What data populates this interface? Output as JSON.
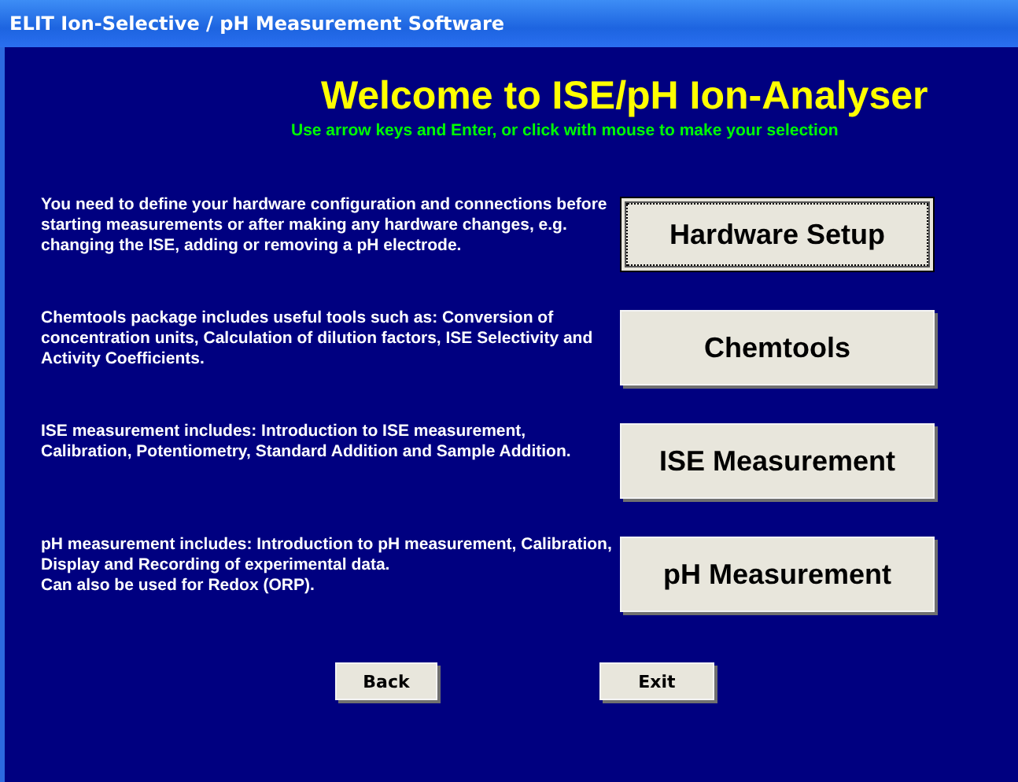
{
  "window": {
    "title": "ELIT Ion-Selective / pH Measurement Software"
  },
  "heading": "Welcome to ISE/pH Ion-Analyser",
  "subheading": "Use arrow keys and Enter, or click with mouse to make your selection",
  "options": [
    {
      "description": "You need to define your hardware configuration and connections before starting measurements or after making any hardware changes, e.g. changing the ISE,  adding or removing a pH electrode.",
      "button": "Hardware Setup",
      "selected": true
    },
    {
      "description": "Chemtools package includes useful tools such as: Conversion of concentration units, Calculation of dilution factors, ISE Selectivity and Activity Coefficients.",
      "button": "Chemtools",
      "selected": false
    },
    {
      "description": "ISE measurement includes: Introduction to ISE measurement, Calibration,  Potentiometry, Standard Addition and Sample Addition.",
      "button": "ISE Measurement",
      "selected": false
    },
    {
      "description": "pH measurement includes: Introduction to pH measurement, Calibration, Display and Recording of experimental data.\nCan also be used for Redox (ORP).",
      "button": "pH Measurement",
      "selected": false
    }
  ],
  "footer_buttons": [
    "Back",
    "Exit"
  ]
}
